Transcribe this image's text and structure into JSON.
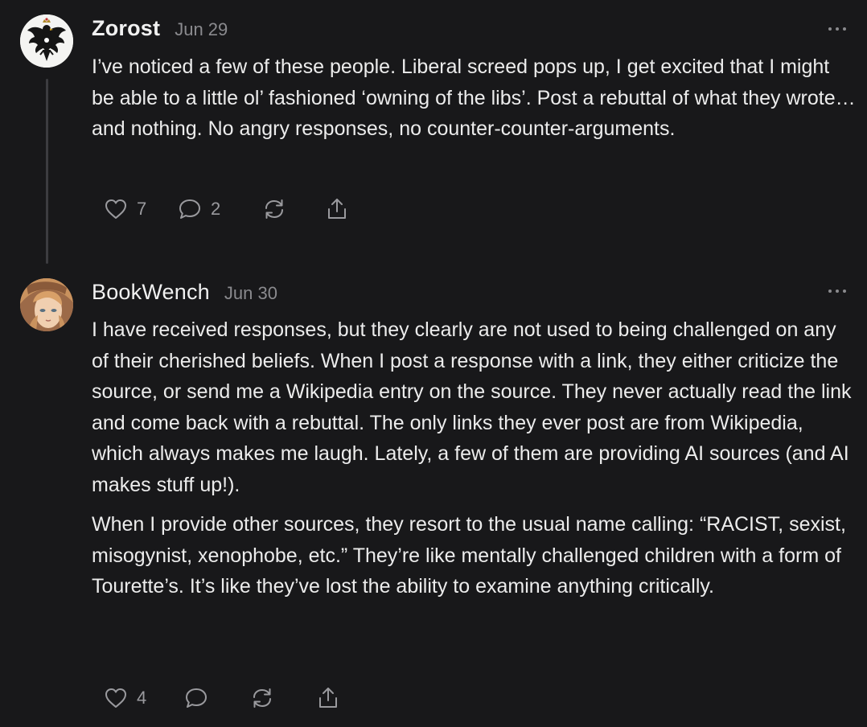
{
  "comments": [
    {
      "author": "Zorost",
      "date": "Jun 29",
      "paragraphs": [
        "I’ve noticed a few of these people. Liberal screed pops up, I get excited that I might be able to a little ol’ fashioned ‘owning of the libs’. Post a rebuttal of what they wrote… and nothing. No angry responses, no counter-counter-arguments."
      ],
      "likes": "7",
      "replies": "2"
    },
    {
      "author": "BookWench",
      "date": "Jun 30",
      "paragraphs": [
        "I have received responses, but they clearly are not used to being challenged on any of their cherished beliefs. When I post a response with a link, they either criticize the source, or send me a Wikipedia entry on the source. They never actually read the link and come back with a rebuttal. The only links they ever post are from Wikipedia, which always makes me laugh. Lately, a few of them are providing AI sources (and AI makes stuff up!).",
        "When I provide other sources, they resort to the usual name calling: “RACIST, sexist, misogynist, xenophobe, etc.” They’re like mentally challenged children with a form of Tourette’s. It’s like they’ve lost the ability to examine anything critically."
      ],
      "likes": "4"
    }
  ],
  "icons": {
    "like": "heart-icon",
    "reply": "comment-bubble-icon",
    "restack": "restack-arrows-icon",
    "share": "share-upload-icon",
    "more": "ellipsis-icon"
  }
}
